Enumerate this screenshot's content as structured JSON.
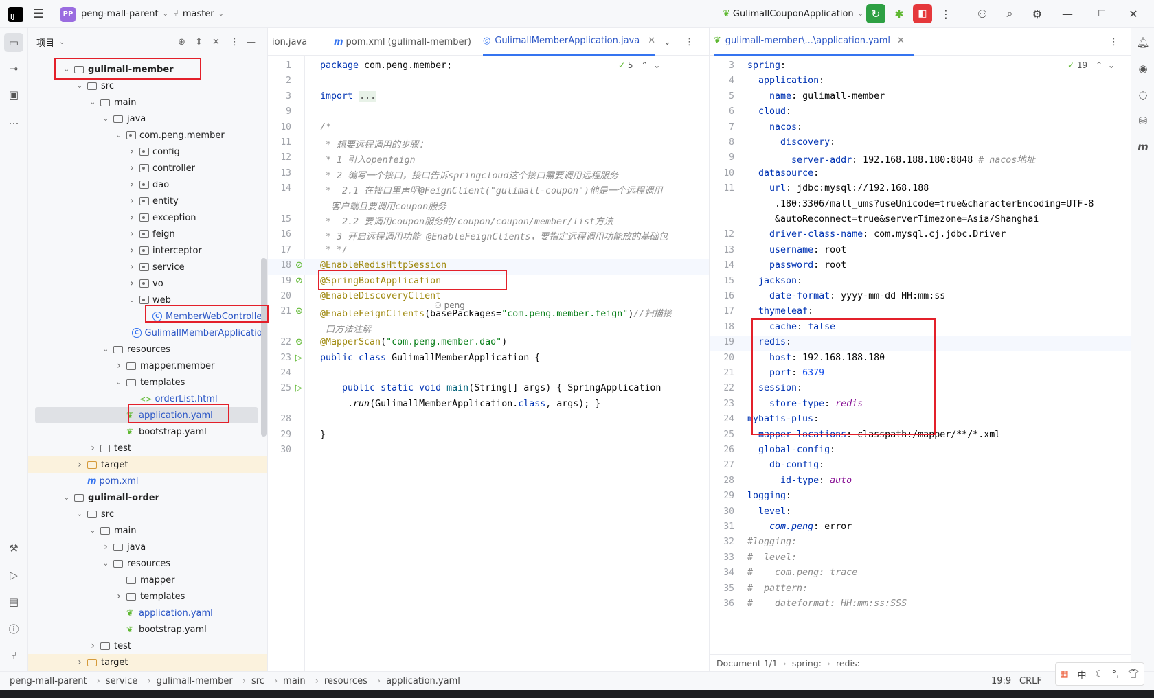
{
  "titlebar": {
    "logo": "IJ",
    "project_badge": "PP",
    "project_name": "peng-mall-parent",
    "branch": "master",
    "run_config": "GulimallCouponApplication"
  },
  "project_panel": {
    "title": "项目",
    "tree": [
      {
        "label": "gulimall-member",
        "kind": "module",
        "indent": 3,
        "arrow": "v",
        "bold": true
      },
      {
        "label": "src",
        "kind": "folder",
        "indent": 4,
        "arrow": "v"
      },
      {
        "label": "main",
        "kind": "folder",
        "indent": 5,
        "arrow": "v"
      },
      {
        "label": "java",
        "kind": "folder",
        "indent": 6,
        "arrow": "v"
      },
      {
        "label": "com.peng.member",
        "kind": "pkg",
        "indent": 7,
        "arrow": "v"
      },
      {
        "label": "config",
        "kind": "pkg",
        "indent": 8,
        "arrow": ">"
      },
      {
        "label": "controller",
        "kind": "pkg",
        "indent": 8,
        "arrow": ">"
      },
      {
        "label": "dao",
        "kind": "pkg",
        "indent": 8,
        "arrow": ">"
      },
      {
        "label": "entity",
        "kind": "pkg",
        "indent": 8,
        "arrow": ">"
      },
      {
        "label": "exception",
        "kind": "pkg",
        "indent": 8,
        "arrow": ">"
      },
      {
        "label": "feign",
        "kind": "pkg",
        "indent": 8,
        "arrow": ">"
      },
      {
        "label": "interceptor",
        "kind": "pkg",
        "indent": 8,
        "arrow": ">"
      },
      {
        "label": "service",
        "kind": "pkg",
        "indent": 8,
        "arrow": ">"
      },
      {
        "label": "vo",
        "kind": "pkg",
        "indent": 8,
        "arrow": ">"
      },
      {
        "label": "web",
        "kind": "pkg",
        "indent": 8,
        "arrow": "v"
      },
      {
        "label": "MemberWebController",
        "kind": "class",
        "indent": 9,
        "arrow": ""
      },
      {
        "label": "GulimallMemberApplication",
        "kind": "class",
        "indent": 8,
        "arrow": ""
      },
      {
        "label": "resources",
        "kind": "folder",
        "indent": 6,
        "arrow": "v"
      },
      {
        "label": "mapper.member",
        "kind": "folder",
        "indent": 7,
        "arrow": ">"
      },
      {
        "label": "templates",
        "kind": "folder",
        "indent": 7,
        "arrow": "v"
      },
      {
        "label": "orderList.html",
        "kind": "html",
        "indent": 8,
        "arrow": ""
      },
      {
        "label": "application.yaml",
        "kind": "yaml",
        "indent": 7,
        "arrow": "",
        "selected": true
      },
      {
        "label": "bootstrap.yaml",
        "kind": "yaml",
        "indent": 7,
        "arrow": ""
      },
      {
        "label": "test",
        "kind": "folder",
        "indent": 5,
        "arrow": ">"
      },
      {
        "label": "target",
        "kind": "target",
        "indent": 4,
        "arrow": ">"
      },
      {
        "label": "pom.xml",
        "kind": "maven",
        "indent": 4,
        "arrow": ""
      },
      {
        "label": "gulimall-order",
        "kind": "module",
        "indent": 3,
        "arrow": "v",
        "bold": true
      },
      {
        "label": "src",
        "kind": "folder",
        "indent": 4,
        "arrow": "v"
      },
      {
        "label": "main",
        "kind": "folder",
        "indent": 5,
        "arrow": "v"
      },
      {
        "label": "java",
        "kind": "folder",
        "indent": 6,
        "arrow": ">"
      },
      {
        "label": "resources",
        "kind": "folder",
        "indent": 6,
        "arrow": "v"
      },
      {
        "label": "mapper",
        "kind": "folder",
        "indent": 7,
        "arrow": ""
      },
      {
        "label": "templates",
        "kind": "folder",
        "indent": 7,
        "arrow": ">"
      },
      {
        "label": "application.yaml",
        "kind": "yaml",
        "indent": 7,
        "arrow": ""
      },
      {
        "label": "bootstrap.yaml",
        "kind": "yaml",
        "indent": 7,
        "arrow": ""
      },
      {
        "label": "test",
        "kind": "folder",
        "indent": 5,
        "arrow": ">"
      },
      {
        "label": "target",
        "kind": "target",
        "indent": 4,
        "arrow": ">"
      }
    ]
  },
  "editor_left": {
    "tabs": [
      {
        "label": "ion.java"
      },
      {
        "label": "pom.xml (gulimall-member)"
      },
      {
        "label": "GulimallMemberApplication.java",
        "active": true
      }
    ],
    "inspection_count": "5",
    "author_hint": "peng",
    "lines": [
      {
        "n": "1",
        "html": "<span class='kw'>package</span> com.peng.member;"
      },
      {
        "n": "2",
        "html": ""
      },
      {
        "n": "3",
        "html": "<span class='kw'>import</span> <span style='background:#e8f2e8;border:1px solid #bcd6bc;color:#555'>...</span>"
      },
      {
        "n": "9",
        "html": ""
      },
      {
        "n": "10",
        "html": "<span class='cmt'>/*</span>"
      },
      {
        "n": "11",
        "html": "<span class='cmt'> * 想要远程调用的步骤：</span>"
      },
      {
        "n": "12",
        "html": "<span class='cmt'> * 1 引入openfeign</span>"
      },
      {
        "n": "13",
        "html": "<span class='cmt'> * 2 编写一个接口，接口告诉springcloud这个接口需要调用远程服务</span>"
      },
      {
        "n": "14",
        "html": "<span class='cmt'> *  2.1 在接口里声明@FeignClient(\"gulimall-coupon\")他是一个远程调用</span>"
      },
      {
        "n": "",
        "html": "<span class='cmt'>  客户端且要调用coupon服务</span>"
      },
      {
        "n": "15",
        "html": "<span class='cmt'> *  2.2 要调用coupon服务的/coupon/coupon/member/list方法</span>"
      },
      {
        "n": "16",
        "html": "<span class='cmt'> * 3 开启远程调用功能 @EnableFeignClients，要指定远程调用功能放的基础包</span>"
      },
      {
        "n": "17",
        "html": "<span class='cmt'> * */</span>"
      },
      {
        "n": "18",
        "html": "<span class='ann'>@EnableRedisHttpSession</span>"
      },
      {
        "n": "19",
        "html": "<span class='ann'>@SpringBootApplication</span>"
      },
      {
        "n": "20",
        "html": "<span class='ann'>@EnableDiscoveryClient</span>"
      },
      {
        "n": "21",
        "html": "<span class='ann'>@EnableFeignClients</span>(basePackages=<span class='str'>\"com.peng.member.feign\"</span>)<span class='cmt'>//扫描接</span>"
      },
      {
        "n": "",
        "html": "<span class='cmt'> 口方法注解</span>"
      },
      {
        "n": "22",
        "html": "<span class='ann'>@MapperScan</span>(<span class='str'>\"com.peng.member.dao\"</span>)"
      },
      {
        "n": "23",
        "html": "<span class='kw'>public class</span> GulimallMemberApplication {"
      },
      {
        "n": "24",
        "html": ""
      },
      {
        "n": "25",
        "html": "    <span class='kw'>public static void</span> <span style='color:#00627a'>main</span>(String[] args) { SpringApplication"
      },
      {
        "n": "",
        "html": "     .<i>run</i>(GulimallMemberApplication.<span class='kw'>class</span>, args); }"
      },
      {
        "n": "28",
        "html": ""
      },
      {
        "n": "29",
        "html": "}"
      },
      {
        "n": "30",
        "html": ""
      }
    ]
  },
  "editor_right": {
    "tab": "gulimall-member\\...\\application.yaml",
    "inspection_count": "19",
    "lines": [
      {
        "n": "3",
        "html": "<span class='ykey'>spring</span>:"
      },
      {
        "n": "4",
        "html": "  <span class='ykey'>application</span>:"
      },
      {
        "n": "5",
        "html": "    <span class='ykey'>name</span>: gulimall-member"
      },
      {
        "n": "6",
        "html": "  <span class='ykey'>cloud</span>:"
      },
      {
        "n": "7",
        "html": "    <span class='ykey'>nacos</span>:"
      },
      {
        "n": "8",
        "html": "      <span class='ykey'>discovery</span>:"
      },
      {
        "n": "9",
        "html": "        <span class='ykey'>server-addr</span>: 192.168.188.180:8848 <span class='ycmt'># nacos地址</span>"
      },
      {
        "n": "10",
        "html": "  <span class='ykey'>datasource</span>:"
      },
      {
        "n": "11",
        "html": "    <span class='ykey'>url</span>: jdbc:mysql://192.168.188"
      },
      {
        "n": "",
        "html": "     .180:3306/mall_ums?useUnicode=true&characterEncoding=UTF-8"
      },
      {
        "n": "",
        "html": "     &autoReconnect=true&serverTimezone=Asia/Shanghai"
      },
      {
        "n": "12",
        "html": "    <span class='ykey'>driver-class-name</span>: com.mysql.cj.jdbc.Driver"
      },
      {
        "n": "13",
        "html": "    <span class='ykey'>username</span>: root"
      },
      {
        "n": "14",
        "html": "    <span class='ykey'>password</span>: root"
      },
      {
        "n": "15",
        "html": "  <span class='ykey'>jackson</span>:"
      },
      {
        "n": "16",
        "html": "    <span class='ykey'>date-format</span>: yyyy-mm-dd HH:mm:ss"
      },
      {
        "n": "17",
        "html": "  <span class='ykey'>thymeleaf</span>:"
      },
      {
        "n": "18",
        "html": "    <span class='ykey'>cache</span>: <span class='kw'>false</span>"
      },
      {
        "n": "19",
        "html": "  <span class='ykey'>redis</span>:"
      },
      {
        "n": "20",
        "html": "    <span class='ykey'>host</span>: 192.168.188.180"
      },
      {
        "n": "21",
        "html": "    <span class='ykey'>port</span>: <span class='ynum'>6379</span>"
      },
      {
        "n": "22",
        "html": "  <span class='ykey'>session</span>:"
      },
      {
        "n": "23",
        "html": "    <span class='ykey'>store-type</span>: <span class='yital'>redis</span>"
      },
      {
        "n": "24",
        "html": "<span class='ykey'>mybatis-plus</span>:"
      },
      {
        "n": "25",
        "html": "  <span class='ykey'>mapper-locations</span>: classpath:/mapper/**/*.xml"
      },
      {
        "n": "26",
        "html": "  <span class='ykey'>global-config</span>:"
      },
      {
        "n": "27",
        "html": "    <span class='ykey'>db-config</span>:"
      },
      {
        "n": "28",
        "html": "      <span class='ykey'>id-type</span>: <span class='yital'>auto</span>"
      },
      {
        "n": "29",
        "html": "<span class='ykey'>logging</span>:"
      },
      {
        "n": "30",
        "html": "  <span class='ykey'>level</span>:"
      },
      {
        "n": "31",
        "html": "    <span class='ykey'><i>com.peng</i></span>: error"
      },
      {
        "n": "32",
        "html": "<span class='ycmt'>#logging:</span>"
      },
      {
        "n": "33",
        "html": "<span class='ycmt'>#  level:</span>"
      },
      {
        "n": "34",
        "html": "<span class='ycmt'>#    com.peng: trace</span>"
      },
      {
        "n": "35",
        "html": "<span class='ycmt'>#  pattern:</span>"
      },
      {
        "n": "36",
        "html": "<span class='ycmt'>#    dateformat: HH:mm:ss:SSS</span>"
      }
    ],
    "breadcrumb": [
      "Document 1/1",
      "spring:",
      "redis:"
    ]
  },
  "statusbar": {
    "crumbs": [
      "peng-mall-parent",
      "service",
      "gulimall-member",
      "src",
      "main",
      "resources",
      "application.yaml"
    ],
    "position": "19:9",
    "line_sep": "CRLF"
  },
  "ime": {
    "lang": "中"
  }
}
